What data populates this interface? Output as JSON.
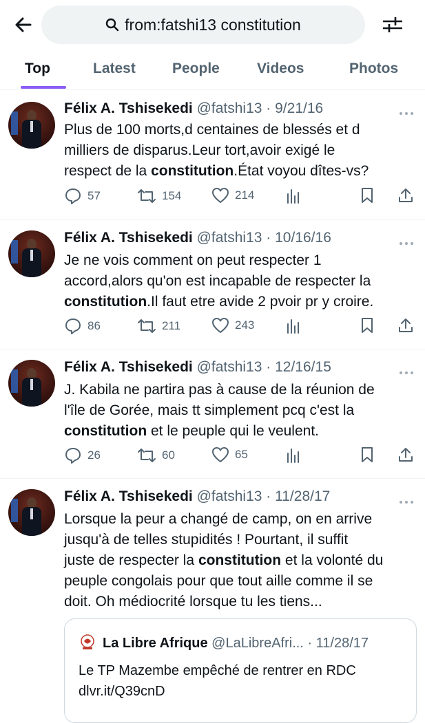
{
  "search": {
    "query": "from:fatshi13 constitution"
  },
  "tabs": [
    "Top",
    "Latest",
    "People",
    "Videos",
    "Photos"
  ],
  "tweets": [
    {
      "name": "Félix A. Tshisekedi",
      "handle": "@fatshi13",
      "date": "· 9/21/16",
      "lines": [
        [
          "Plus de 100 morts,d centaines de blessés et d",
          "",
          ""
        ],
        [
          "milliers de disparus.Leur tort,avoir exigé le",
          "",
          ""
        ],
        [
          "respect de la ",
          "constitution",
          ".État voyou dîtes-vs?"
        ]
      ],
      "replies": "57",
      "retweets": "154",
      "likes": "214"
    },
    {
      "name": "Félix A. Tshisekedi",
      "handle": "@fatshi13",
      "date": "· 10/16/16",
      "lines": [
        [
          "Je ne vois comment on peut respecter 1",
          "",
          ""
        ],
        [
          "accord,alors qu'on est incapable de respecter la",
          "",
          ""
        ],
        [
          "",
          "constitution",
          ".Il faut etre avide 2 pvoir pr y croire."
        ]
      ],
      "replies": "86",
      "retweets": "211",
      "likes": "243"
    },
    {
      "name": "Félix A. Tshisekedi",
      "handle": "@fatshi13",
      "date": "· 12/16/15",
      "lines": [
        [
          "J. Kabila ne partira pas à cause de la réunion de",
          "",
          ""
        ],
        [
          "l'île de Gorée, mais tt simplement pcq c'est la",
          "",
          ""
        ],
        [
          "",
          "constitution",
          " et le peuple qui le veulent."
        ]
      ],
      "replies": "26",
      "retweets": "60",
      "likes": "65"
    },
    {
      "name": "Félix A. Tshisekedi",
      "handle": "@fatshi13",
      "date": "· 11/28/17",
      "lines": [
        [
          "Lorsque la peur a changé de camp, on en arrive",
          "",
          ""
        ],
        [
          "jusqu'à de telles stupidités ! Pourtant, il suffit",
          "",
          ""
        ],
        [
          "juste de respecter la ",
          "constitution",
          " et la volonté du"
        ],
        [
          "peuple congolais pour que tout aille comme il se",
          "",
          ""
        ],
        [
          "doit. Oh médiocrité lorsque tu les tiens...",
          "",
          ""
        ]
      ]
    }
  ],
  "quote": {
    "name": "La Libre Afrique",
    "handle": "@LaLibreAfri...",
    "date": "· 11/28/17",
    "line1": "Le TP Mazembe empêché de rentrer en RDC",
    "line2": "dlvr.it/Q39cnD"
  },
  "colors": {
    "accent": "#8b5cf6",
    "secondary_text": "#536471",
    "divider": "#eff3f4"
  }
}
